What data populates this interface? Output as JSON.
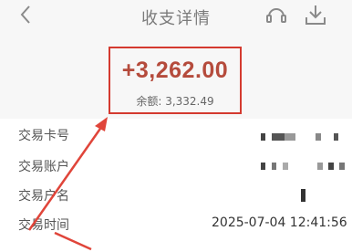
{
  "header": {
    "title": "收支详情",
    "back_icon": "chevron-left-icon",
    "headset_icon": "headset-icon",
    "download_icon": "download-icon"
  },
  "transaction": {
    "amount": "+3,262.00",
    "balance": "余额: 3,332.49",
    "amount_color": "#b54b3c",
    "highlight_color": "#d43a2f"
  },
  "details": {
    "card_label": "交易卡号",
    "account_label": "交易账户",
    "name_label": "交易户名",
    "time_label": "交易时间",
    "time_value": "2025-07-04 12:41:56"
  }
}
